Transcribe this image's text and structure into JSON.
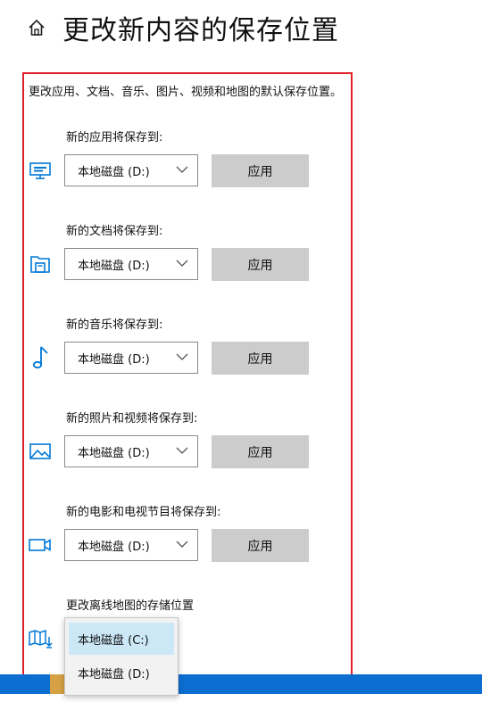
{
  "header": {
    "title": "更改新内容的保存位置"
  },
  "description": "更改应用、文档、音乐、图片、视频和地图的默认保存位置。",
  "sections": [
    {
      "label": "新的应用将保存到:",
      "dropdown": "本地磁盘 (D:)",
      "button": "应用",
      "icon": "monitor-icon"
    },
    {
      "label": "新的文档将保存到:",
      "dropdown": "本地磁盘 (D:)",
      "button": "应用",
      "icon": "folder-icon"
    },
    {
      "label": "新的音乐将保存到:",
      "dropdown": "本地磁盘 (D:)",
      "button": "应用",
      "icon": "music-note-icon"
    },
    {
      "label": "新的照片和视频将保存到:",
      "dropdown": "本地磁盘 (D:)",
      "button": "应用",
      "icon": "picture-icon"
    },
    {
      "label": "新的电影和电视节目将保存到:",
      "dropdown": "本地磁盘 (D:)",
      "button": "应用",
      "icon": "video-camera-icon"
    }
  ],
  "offline_maps": {
    "label": "更改离线地图的存储位置",
    "icon": "map-download-icon",
    "options": [
      "本地磁盘 (C:)",
      "本地磁盘 (D:)"
    ],
    "selected": "本地磁盘 (C:)"
  },
  "colors": {
    "accent": "#0078d7",
    "highlight_border": "#e0202a",
    "taskbar": "#0c6ed1"
  }
}
